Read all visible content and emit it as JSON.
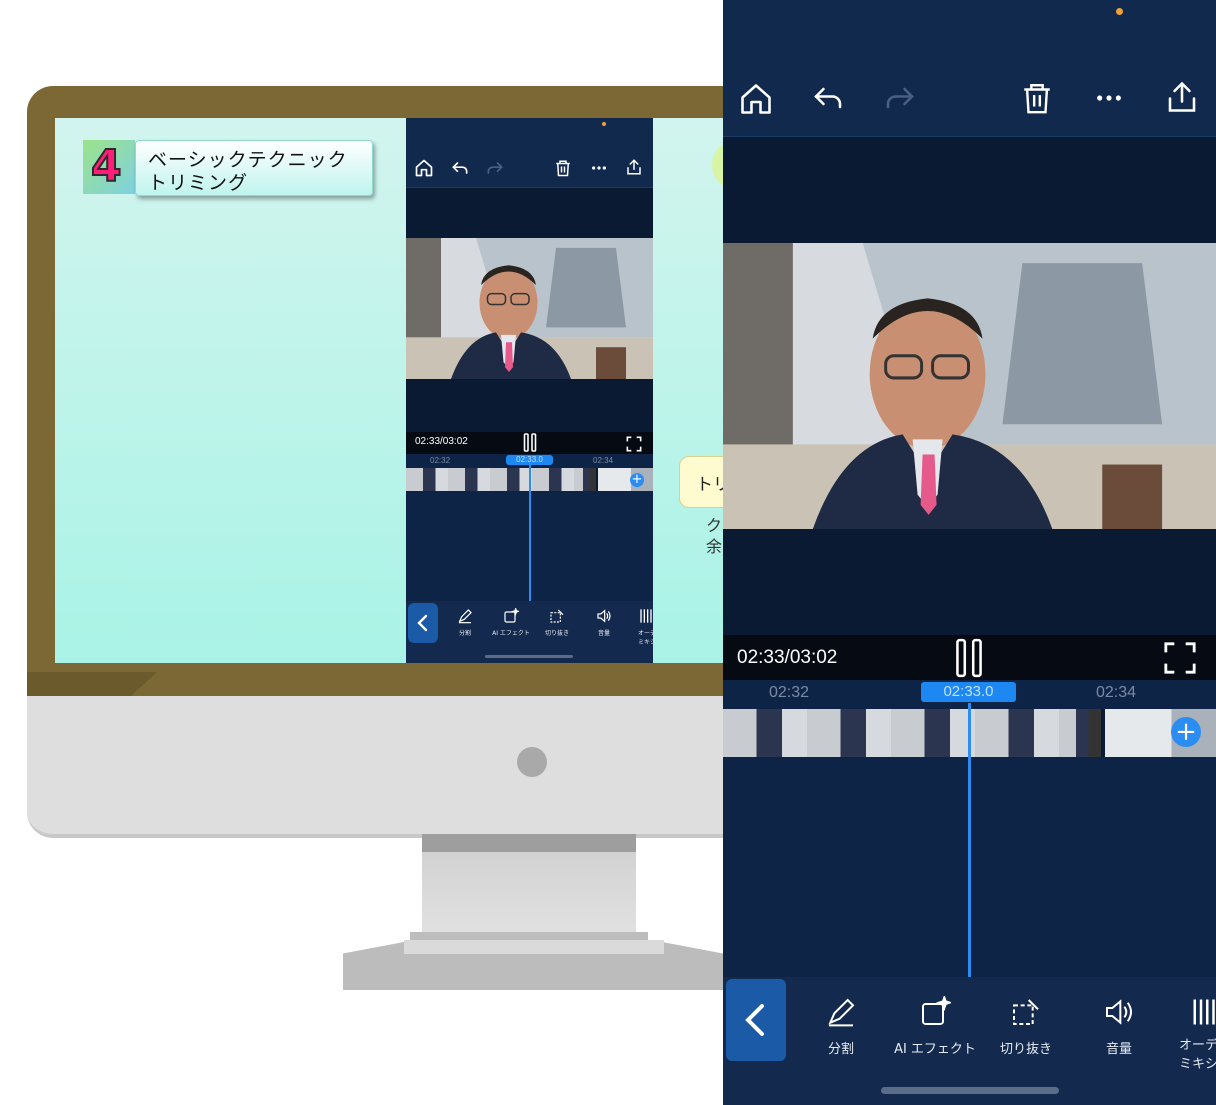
{
  "slide": {
    "number": "4",
    "title_line1": "ベーシックテクニック",
    "title_line2": "トリミング",
    "bubble_text": "トリ",
    "side_text1": "ク",
    "side_text2": "余"
  },
  "editor": {
    "timecode": "02:33/03:02",
    "ruler_ticks": [
      "02:32",
      "02:33.0",
      "02:34"
    ],
    "active_tick": "02:33.0",
    "tools": [
      {
        "icon": "pencil-icon",
        "label": "分割"
      },
      {
        "icon": "ai-effect-icon",
        "label": "AI エフェクト"
      },
      {
        "icon": "crop-icon",
        "label": "切り抜き"
      },
      {
        "icon": "volume-icon",
        "label": "音量"
      },
      {
        "icon": "audio-mixer-icon",
        "label_line1": "オーデ",
        "label_line2": "ミキシ"
      }
    ],
    "colors": {
      "background": "#0e2447",
      "accent": "#1e88f2",
      "header": "#12294e",
      "notification_dot": "#f0a03a"
    }
  }
}
